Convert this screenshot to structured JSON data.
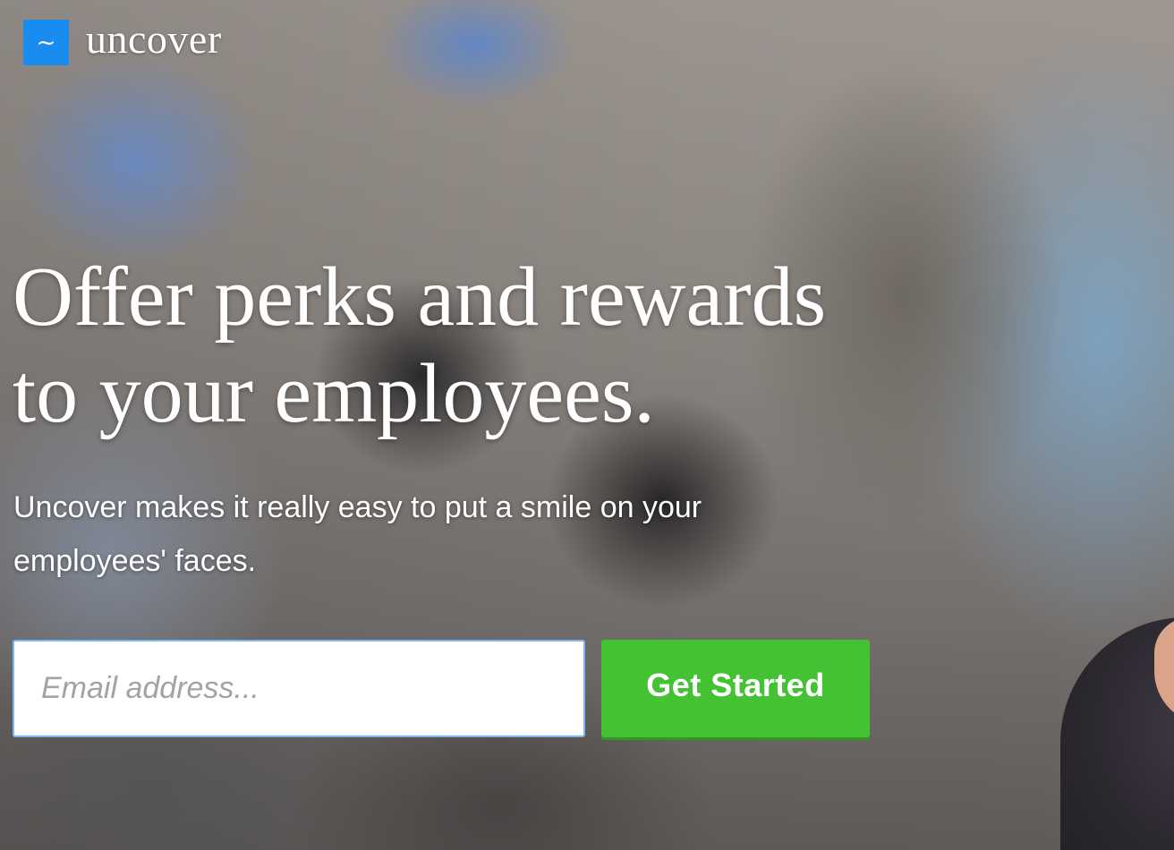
{
  "brand": {
    "name": "uncover",
    "logo_icon": "tilde-icon",
    "logo_glyph": "~",
    "logo_color": "#1a8cf0"
  },
  "hero": {
    "headline_line1": "Offer perks and rewards",
    "headline_line2": "to your employees.",
    "subheadline": "Uncover makes it really easy to put a smile on your employees' faces.",
    "background": "blurred-office-photo"
  },
  "signup": {
    "email_placeholder": "Email address...",
    "email_value": "",
    "cta_label": "Get Started",
    "cta_color": "#45c234",
    "input_border_color": "#7cb8ef"
  }
}
